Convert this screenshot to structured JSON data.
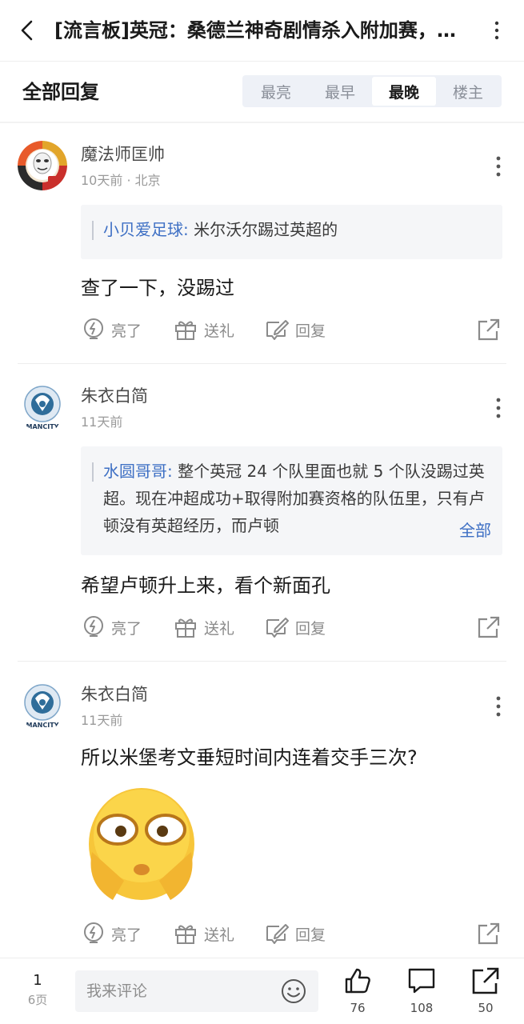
{
  "header": {
    "title": "[流言板]英冠：桑德兰神奇剧情杀入附加赛，将与考文垂争夺英超席位"
  },
  "replies_section": {
    "title": "全部回复",
    "sort_tabs": [
      "最亮",
      "最早",
      "最晚",
      "楼主"
    ],
    "active_sort": "最晚"
  },
  "actions": {
    "light": "亮了",
    "gift": "送礼",
    "reply": "回复"
  },
  "posts": [
    {
      "author": "魔法师匡帅",
      "time": "10天前",
      "location": "北京",
      "quote_user": "小贝爱足球:",
      "quote_text": "米尔沃尔踢过英超的",
      "content": "查了一下，没踢过"
    },
    {
      "author": "朱衣白简",
      "time": "11天前",
      "quote_user": "水圆哥哥:",
      "quote_text": "整个英冠 24 个队里面也就 5 个队没踢过英超。现在冲超成功+取得附加赛资格的队伍里，只有卢顿没有英超经历，而卢顿",
      "quote_more": "全部",
      "content": "希望卢顿升上来，看个新面孔"
    },
    {
      "author": "朱衣白简",
      "time": "11天前",
      "content": "所以米堡考文垂短时间内连着交手三次?"
    }
  ],
  "bottom": {
    "page_current": "1",
    "page_total": "6页",
    "comment_placeholder": "我来评论",
    "likes": "76",
    "comments": "108",
    "shares": "50"
  },
  "colors": {
    "link": "#3d6fc4",
    "muted": "#8a8a8a",
    "tab_bg": "#eef1f7"
  }
}
